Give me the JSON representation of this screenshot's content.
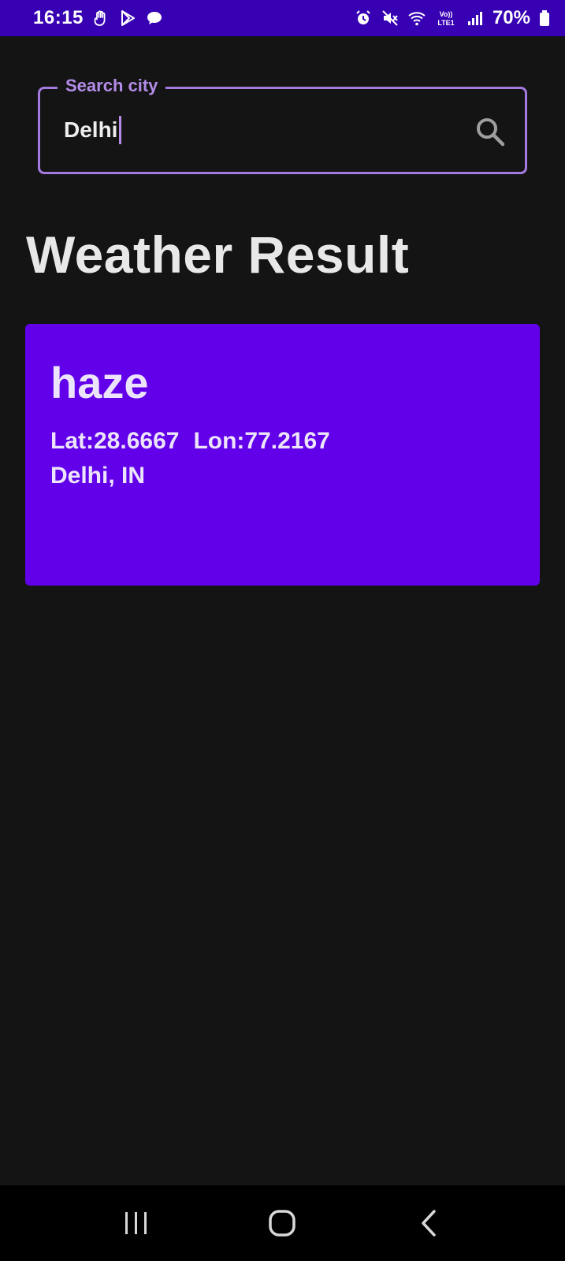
{
  "status_bar": {
    "time": "16:15",
    "battery_text": "70%",
    "left_icons": [
      "gesture-icon",
      "play-store-icon",
      "chat-bubble-icon"
    ],
    "right_icons": [
      "alarm-icon",
      "mute-icon",
      "wifi-icon",
      "volte-icon",
      "signal-icon",
      "battery-icon"
    ],
    "network_label": "Vo)) LTE1",
    "background": "#3700b3"
  },
  "search": {
    "label": "Search city",
    "value": "Delhi",
    "border_color": "#a47ae0"
  },
  "page": {
    "title": "Weather Result"
  },
  "result_card": {
    "condition": "haze",
    "lat": "Lat:28.6667",
    "lon": "Lon:77.2167",
    "location": "Delhi, IN",
    "background": "#6200ea"
  },
  "nav_bar": {
    "buttons": [
      "recent-apps-icon",
      "home-icon",
      "back-icon"
    ]
  }
}
